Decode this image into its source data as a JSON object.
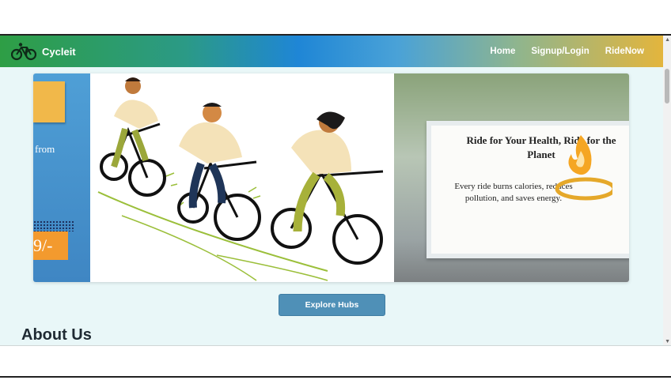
{
  "navbar": {
    "brand": "Cycleit",
    "links": [
      "Home",
      "Signup/Login",
      "RideNow"
    ]
  },
  "carousel": {
    "left_slide": {
      "text_from": "from",
      "price": "9/-"
    },
    "right_slide": {
      "title": "Ride for Your Health, Ride for the Planet",
      "text": "Every ride burns calories, reduces pollution, and saves energy."
    }
  },
  "cta": {
    "explore_label": "Explore Hubs"
  },
  "section": {
    "about_title": "About Us"
  },
  "colors": {
    "nav_start": "#2e9e45",
    "nav_mid": "#1f86d6",
    "nav_end": "#e3b53d",
    "button": "#4f90b7"
  }
}
